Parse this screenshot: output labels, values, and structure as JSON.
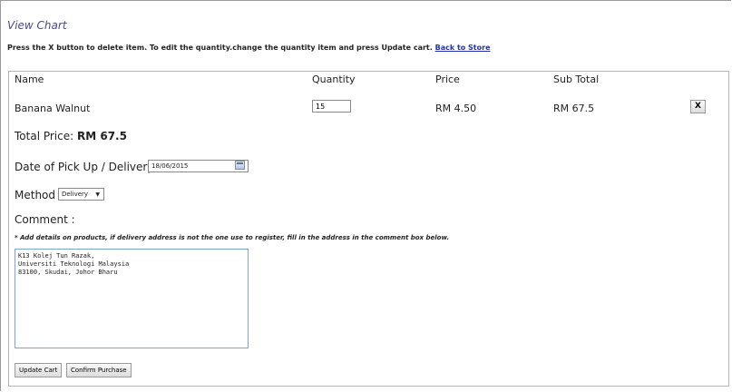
{
  "page": {
    "title": "View Chart",
    "instructions": "Press the X button to delete item. To edit the quantity.change the quantity item and press Update cart.",
    "back_link": "Back to Store"
  },
  "cart": {
    "headers": {
      "name": "Name",
      "quantity": "Quantity",
      "price": "Price",
      "subtotal": "Sub Total"
    },
    "items": [
      {
        "name": "Banana Walnut",
        "quantity": "15",
        "price": "RM 4.50",
        "subtotal": "RM 67.5",
        "delete_label": "X"
      }
    ],
    "total_label": "Total Price:",
    "total_value": "RM 67.5"
  },
  "form": {
    "date_label": "Date of Pick Up / Delivery :",
    "date_value": "18/06/2015",
    "method_label": "Method :",
    "method_value": "Delivery",
    "comment_label": "Comment :",
    "comment_note": "* Add details on products, if delivery address is not the one use to register, fill in the address in the comment box below.",
    "comment_value": "K13 Kolej Tun Razak,\nUniversiti Teknologi Malaysia\n83100, Skudai, Johor Bharu"
  },
  "buttons": {
    "update": "Update Cart",
    "confirm": "Confirm Purchase"
  },
  "icons": {
    "calendar": "calendar-icon",
    "dropdown": "chevron-down-icon"
  }
}
